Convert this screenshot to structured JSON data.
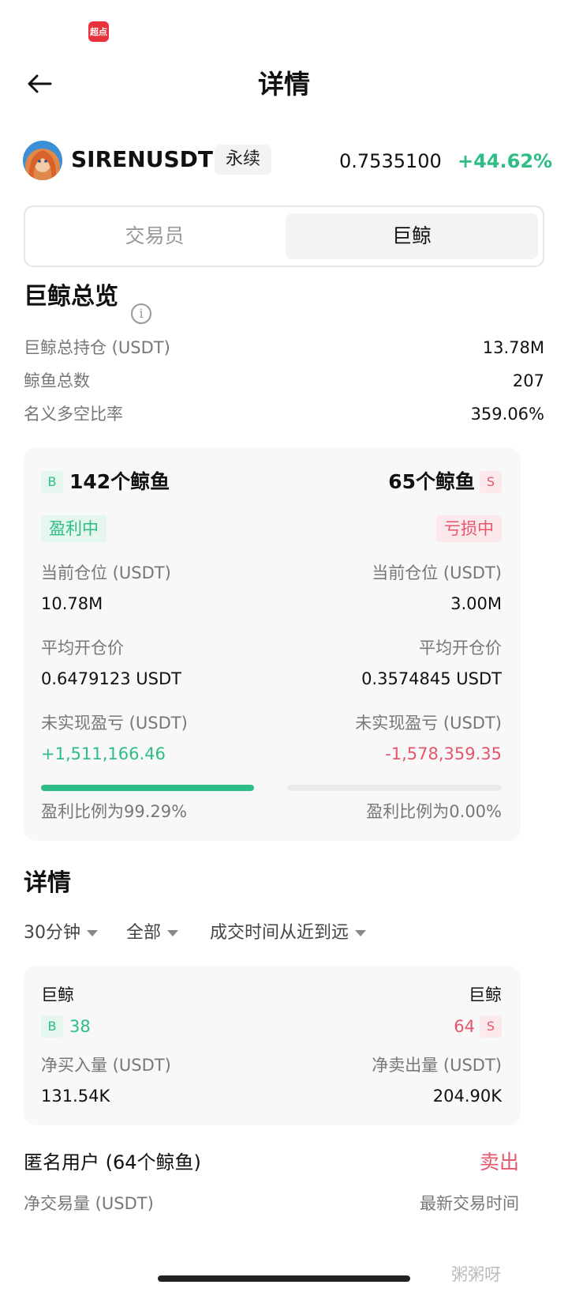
{
  "status_bar": {
    "app_badge": "超点"
  },
  "header": {
    "title": "详情"
  },
  "ticker": {
    "symbol": "SIRENUSDT",
    "contract_type": "永续",
    "price": "0.7535100",
    "change": "+44.62%"
  },
  "tabs": [
    {
      "label": "交易员",
      "active": false
    },
    {
      "label": "巨鲸",
      "active": true
    }
  ],
  "overview": {
    "title": "巨鲸总览",
    "rows": [
      {
        "label": "巨鲸总持仓 (USDT)",
        "value": "13.78M"
      },
      {
        "label": "鲸鱼总数",
        "value": "207"
      },
      {
        "label": "名义多空比率",
        "value": "359.06%"
      }
    ]
  },
  "summary": {
    "long": {
      "tag": "B",
      "count": "142个鲸鱼",
      "status": "盈利中",
      "position_label": "当前仓位 (USDT)",
      "position": "10.78M",
      "avg_label": "平均开仓价",
      "avg": "0.6479123 USDT",
      "pnl_label": "未实现盈亏 (USDT)",
      "pnl": "+1,511,166.46",
      "ratio_text": "盈利比例为99.29%",
      "ratio": 0.9929
    },
    "short": {
      "tag": "S",
      "count": "65个鲸鱼",
      "status": "亏损中",
      "position_label": "当前仓位 (USDT)",
      "position": "3.00M",
      "avg_label": "平均开仓价",
      "avg": "0.3574845 USDT",
      "pnl_label": "未实现盈亏 (USDT)",
      "pnl": "-1,578,359.35",
      "ratio_text": "盈利比例为0.00%",
      "ratio": 0.0
    }
  },
  "details": {
    "title": "详情",
    "filters": [
      "30分钟",
      "全部",
      "成交时间从近到远"
    ],
    "card": {
      "left": {
        "title": "巨鲸",
        "tag": "B",
        "count": "38",
        "label": "净买入量 (USDT)",
        "value": "131.54K"
      },
      "right": {
        "title": "巨鲸",
        "tag": "S",
        "count": "64",
        "label": "净卖出量 (USDT)",
        "value": "204.90K"
      }
    },
    "anon": {
      "title": "匿名用户 (64个鲸鱼)",
      "action": "卖出",
      "col1": "净交易量 (USDT)",
      "col2": "最新交易时间"
    }
  },
  "watermark": "粥粥呀",
  "colors": {
    "green": "#2ebd85",
    "red": "#e5566b"
  }
}
